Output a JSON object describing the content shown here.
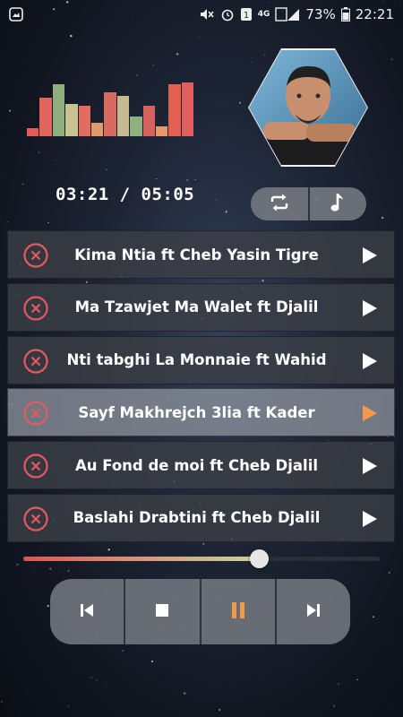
{
  "status_bar": {
    "left_icon": "gallery-icon",
    "battery_percent": "73%",
    "time": "22:21",
    "network_label": "4G",
    "sim_label": "1",
    "icons": [
      "mute-icon",
      "alarm-icon",
      "sim-icon",
      "network-icon",
      "signal-icon",
      "battery-icon"
    ]
  },
  "player": {
    "elapsed_and_total": "03:21 / 05:05",
    "progress": 0.66,
    "visualizer_levels": [
      0.14,
      0.67,
      0.9,
      0.56,
      0.53,
      0.24,
      0.76,
      0.7,
      0.34,
      0.53,
      0.17,
      0.9,
      0.94
    ],
    "visualizer_colors": [
      "#e25b5a",
      "#e0655c",
      "#8fb07e",
      "#c9c291",
      "#e26c60",
      "#e19a6c",
      "#d96a62",
      "#c6b98f",
      "#8fb07e",
      "#d8605d",
      "#e89a6a",
      "#e2604f",
      "#df5e5e"
    ]
  },
  "top_controls": {
    "repeat_icon": "repeat-icon",
    "music_icon": "music-note-icon"
  },
  "tracks": [
    {
      "title": "Kima Ntia ft Cheb Yasin Tigre",
      "active": false
    },
    {
      "title": "Ma Tzawjet Ma Walet ft Djalil",
      "active": false
    },
    {
      "title": "Nti tabghi La Monnaie ft Wahid",
      "active": false
    },
    {
      "title": "Sayf Makhrejch 3lia ft Kader",
      "active": true
    },
    {
      "title": "Au Fond de moi ft Cheb Djalil",
      "active": false
    },
    {
      "title": "Baslahi Drabtini ft Cheb Djalil",
      "active": false
    }
  ],
  "colors": {
    "accent": "#f29a45",
    "remove_icon": "#e45a5f",
    "play_icon": "#ffffff"
  },
  "bottom_controls": [
    "previous-icon",
    "stop-icon",
    "pause-icon",
    "next-icon"
  ]
}
